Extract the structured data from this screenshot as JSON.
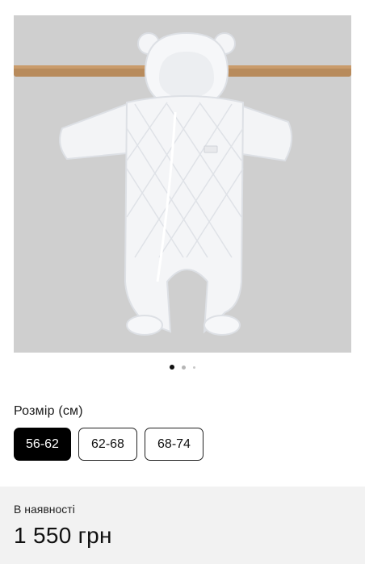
{
  "product": {
    "image_alt": "",
    "gallery": {
      "total": 3,
      "active_index": 0
    }
  },
  "size": {
    "label": "Розмір (см)",
    "options": [
      {
        "label": "56-62",
        "selected": true
      },
      {
        "label": "62-68",
        "selected": false
      },
      {
        "label": "68-74",
        "selected": false
      }
    ]
  },
  "purchase": {
    "availability": "В наявності",
    "price": "1 550 грн"
  },
  "colors": {
    "selected_bg": "#000000",
    "panel_bg": "#f2f2f2",
    "image_bg": "#cfcfcf"
  }
}
